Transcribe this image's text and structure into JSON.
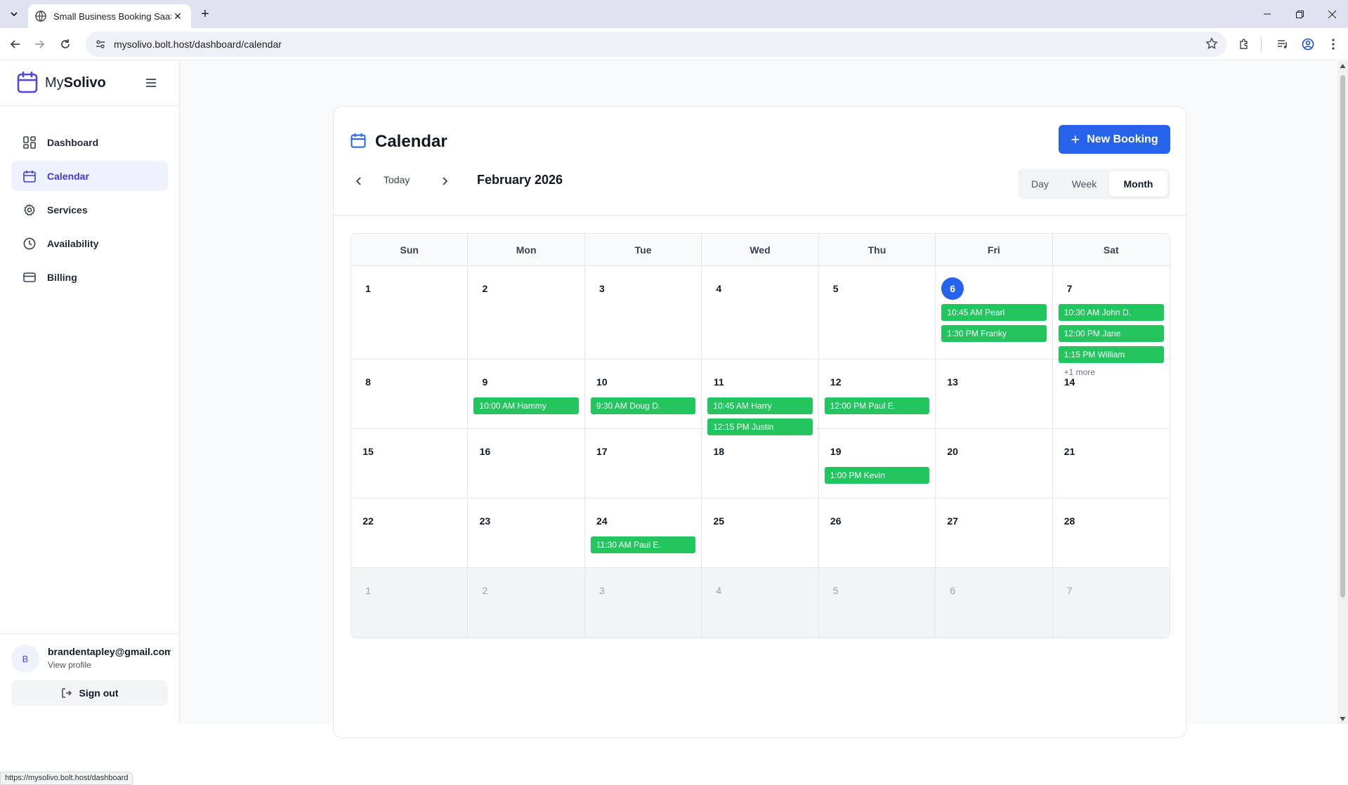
{
  "browser": {
    "tab_title": "Small Business Booking SaaS",
    "url": "mysolivo.bolt.host/dashboard/calendar",
    "status_url": "https://mysolivo.bolt.host/dashboard"
  },
  "brand": {
    "prefix": "My",
    "name": "Solivo"
  },
  "sidebar": {
    "items": [
      {
        "label": "Dashboard",
        "icon": "grid-icon"
      },
      {
        "label": "Calendar",
        "icon": "calendar-icon",
        "active": true
      },
      {
        "label": "Services",
        "icon": "gear-icon"
      },
      {
        "label": "Availability",
        "icon": "clock-icon"
      },
      {
        "label": "Billing",
        "icon": "card-icon"
      }
    ]
  },
  "user": {
    "initial": "B",
    "email": "brandentapley@gmail.com",
    "view_profile": "View profile",
    "sign_out": "Sign out"
  },
  "calendar": {
    "title": "Calendar",
    "new_booking": "New Booking",
    "today": "Today",
    "month_label": "February 2026",
    "views": [
      "Day",
      "Week",
      "Month"
    ],
    "active_view": "Month",
    "weekdays": [
      "Sun",
      "Mon",
      "Tue",
      "Wed",
      "Thu",
      "Fri",
      "Sat"
    ],
    "weeks": [
      [
        {
          "day": "1",
          "events": []
        },
        {
          "day": "2",
          "events": []
        },
        {
          "day": "3",
          "events": []
        },
        {
          "day": "4",
          "events": []
        },
        {
          "day": "5",
          "events": []
        },
        {
          "day": "6",
          "today": true,
          "events": [
            "10:45 AM Pearl",
            "1:30 PM Franky"
          ]
        },
        {
          "day": "7",
          "events": [
            "10:30 AM John D.",
            "12:00 PM Jane",
            "1:15 PM William"
          ],
          "more": "+1 more"
        }
      ],
      [
        {
          "day": "8",
          "events": []
        },
        {
          "day": "9",
          "events": [
            "10:00 AM Hammy"
          ]
        },
        {
          "day": "10",
          "events": [
            "9:30 AM Doug D."
          ]
        },
        {
          "day": "11",
          "events": [
            "10:45 AM Harry",
            "12:15 PM Justin"
          ]
        },
        {
          "day": "12",
          "events": [
            "12:00 PM Paul E."
          ]
        },
        {
          "day": "13",
          "events": []
        },
        {
          "day": "14",
          "events": []
        }
      ],
      [
        {
          "day": "15",
          "events": []
        },
        {
          "day": "16",
          "events": []
        },
        {
          "day": "17",
          "events": []
        },
        {
          "day": "18",
          "events": []
        },
        {
          "day": "19",
          "events": [
            "1:00 PM Kevin"
          ]
        },
        {
          "day": "20",
          "events": []
        },
        {
          "day": "21",
          "events": []
        }
      ],
      [
        {
          "day": "22",
          "events": []
        },
        {
          "day": "23",
          "events": []
        },
        {
          "day": "24",
          "events": [
            "11:30 AM Paul E."
          ]
        },
        {
          "day": "25",
          "events": []
        },
        {
          "day": "26",
          "events": []
        },
        {
          "day": "27",
          "events": []
        },
        {
          "day": "28",
          "events": []
        }
      ],
      [
        {
          "day": "1",
          "outside": true,
          "events": []
        },
        {
          "day": "2",
          "outside": true,
          "events": []
        },
        {
          "day": "3",
          "outside": true,
          "events": []
        },
        {
          "day": "4",
          "outside": true,
          "events": []
        },
        {
          "day": "5",
          "outside": true,
          "events": []
        },
        {
          "day": "6",
          "outside": true,
          "events": []
        },
        {
          "day": "7",
          "outside": true,
          "events": []
        }
      ]
    ]
  },
  "colors": {
    "primary": "#2563eb",
    "event": "#22c55e",
    "active_nav_bg": "#eef2ff",
    "active_nav_text": "#4338ca"
  }
}
